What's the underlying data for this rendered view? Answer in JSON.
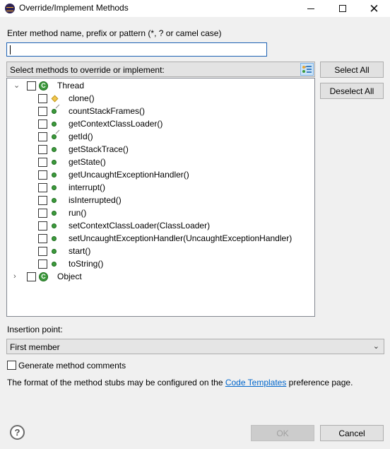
{
  "window": {
    "title": "Override/Implement Methods",
    "close_glyph": "✕"
  },
  "filter": {
    "label": "Enter method name, prefix or pattern (*, ? or camel case)",
    "value": "",
    "placeholder": ""
  },
  "tree": {
    "header": "Select methods to override or implement:",
    "classes": [
      {
        "name": "Thread",
        "expanded": true,
        "icon": "class-icon",
        "icon_letter": "C",
        "methods": [
          {
            "label": "clone()",
            "icon": "diamond-icon"
          },
          {
            "label": "countStackFrames()",
            "icon": "native-method-icon"
          },
          {
            "label": "getContextClassLoader()",
            "icon": "method-icon"
          },
          {
            "label": "getId()",
            "icon": "native-method-icon"
          },
          {
            "label": "getStackTrace()",
            "icon": "method-icon"
          },
          {
            "label": "getState()",
            "icon": "method-icon"
          },
          {
            "label": "getUncaughtExceptionHandler()",
            "icon": "method-icon"
          },
          {
            "label": "interrupt()",
            "icon": "method-icon"
          },
          {
            "label": "isInterrupted()",
            "icon": "method-icon"
          },
          {
            "label": "run()",
            "icon": "method-icon"
          },
          {
            "label": "setContextClassLoader(ClassLoader)",
            "icon": "method-icon"
          },
          {
            "label": "setUncaughtExceptionHandler(UncaughtExceptionHandler)",
            "icon": "method-icon"
          },
          {
            "label": "start()",
            "icon": "method-icon"
          },
          {
            "label": "toString()",
            "icon": "method-icon"
          }
        ]
      },
      {
        "name": "Object",
        "expanded": false,
        "icon": "class-icon",
        "icon_letter": "C",
        "methods": []
      }
    ]
  },
  "buttons": {
    "select_all": "Select All",
    "deselect_all": "Deselect All",
    "ok": "OK",
    "cancel": "Cancel"
  },
  "insertion": {
    "label": "Insertion point:",
    "selected": "First member"
  },
  "generate_comments": {
    "label": "Generate method comments",
    "checked": false
  },
  "info": {
    "prefix": "The format of the method stubs may be configured on the ",
    "link": "Code Templates",
    "suffix": " preference page."
  },
  "help_glyph": "?",
  "colors": {
    "accent": "#1e62b4",
    "method_green": "#3c9a3c",
    "link": "#0066cc"
  }
}
